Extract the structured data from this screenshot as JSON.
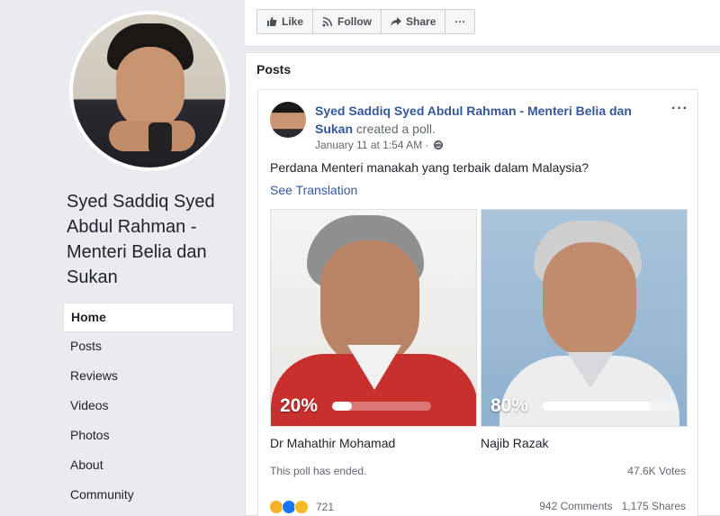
{
  "page": {
    "name": "Syed Saddiq Syed Abdul Rahman - Menteri Belia dan Sukan"
  },
  "nav": {
    "items": [
      {
        "label": "Home",
        "active": true
      },
      {
        "label": "Posts"
      },
      {
        "label": "Reviews"
      },
      {
        "label": "Videos"
      },
      {
        "label": "Photos"
      },
      {
        "label": "About"
      },
      {
        "label": "Community"
      }
    ]
  },
  "actions": {
    "like": "Like",
    "follow": "Follow",
    "share": "Share",
    "more": "···"
  },
  "posts": {
    "title": "Posts"
  },
  "post": {
    "author": "Syed Saddiq Syed Abdul Rahman - Menteri Belia dan Sukan",
    "action": "created a poll.",
    "date": "January 11 at 1:54 AM ·",
    "question": "Perdana Menteri manakah yang terbaik dalam Malaysia?",
    "see_translation": "See Translation",
    "more": "···",
    "poll": {
      "options": [
        {
          "name": "Dr Mahathir Mohamad",
          "percent_label": "20%",
          "value": 0.2
        },
        {
          "name": "Najib Razak",
          "percent_label": "80%",
          "value": 0.8
        }
      ],
      "status": "This poll has ended.",
      "votes": "47.6K Votes"
    },
    "reactions": {
      "count": "721",
      "icons": [
        "haha-icon",
        "like-icon",
        "wow-icon"
      ]
    },
    "engagement": {
      "comments": "942 Comments",
      "shares": "1,175 Shares"
    }
  },
  "colors": {
    "link": "#365899",
    "page_bg": "#e9ebee",
    "option_a_shirt": "#c8302d"
  }
}
